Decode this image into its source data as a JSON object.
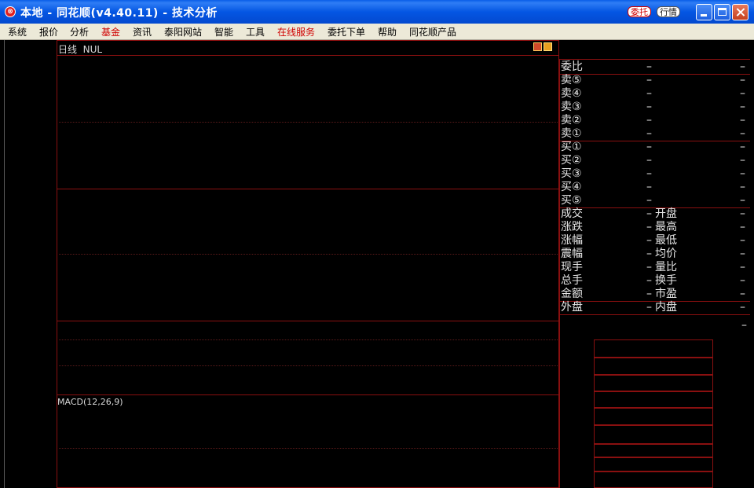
{
  "window": {
    "title": "本地 - 同花顺(v4.40.11) - 技术分析",
    "app_icon": "tonghuashun-logo-icon",
    "entrust_badge": "委托",
    "quotes_badge": "行情"
  },
  "menu": [
    "系统",
    "报价",
    "分析",
    "基金",
    "资讯",
    "泰阳网站",
    "智能",
    "工具",
    "在线服务",
    "委托下单",
    "帮助",
    "同花顺产品"
  ],
  "menu_red": [
    "基金",
    "在线服务"
  ],
  "chart": {
    "title": "日线  NUL",
    "indicator_label": "MACD(12,26,9)"
  },
  "quote_panel": {
    "order_ratio": {
      "label": "委比",
      "value": "–",
      "value2": "–"
    },
    "asks": [
      {
        "label": "卖⑤",
        "price": "–",
        "volume": "–"
      },
      {
        "label": "卖④",
        "price": "–",
        "volume": "–"
      },
      {
        "label": "卖③",
        "price": "–",
        "volume": "–"
      },
      {
        "label": "卖②",
        "price": "–",
        "volume": "–"
      },
      {
        "label": "卖①",
        "price": "–",
        "volume": "–"
      }
    ],
    "bids": [
      {
        "label": "买①",
        "price": "–",
        "volume": "–"
      },
      {
        "label": "买②",
        "price": "–",
        "volume": "–"
      },
      {
        "label": "买③",
        "price": "–",
        "volume": "–"
      },
      {
        "label": "买④",
        "price": "–",
        "volume": "–"
      },
      {
        "label": "买⑤",
        "price": "–",
        "volume": "–"
      }
    ],
    "stats": [
      {
        "label": "成交",
        "value": "–",
        "label2": "开盘",
        "value2": "–"
      },
      {
        "label": "涨跌",
        "value": "–",
        "label2": "最高",
        "value2": "–"
      },
      {
        "label": "涨幅",
        "value": "–",
        "label2": "最低",
        "value2": "–"
      },
      {
        "label": "震幅",
        "value": "–",
        "label2": "均价",
        "value2": "–"
      },
      {
        "label": "现手",
        "value": "–",
        "label2": "量比",
        "value2": "–"
      },
      {
        "label": "总手",
        "value": "–",
        "label2": "换手",
        "value2": "–"
      },
      {
        "label": "金额",
        "value": "–",
        "label2": "市盈",
        "value2": "–"
      },
      {
        "label": "外盘",
        "value": "–",
        "label2": "内盘",
        "value2": "–"
      }
    ],
    "extra_value": "–"
  }
}
